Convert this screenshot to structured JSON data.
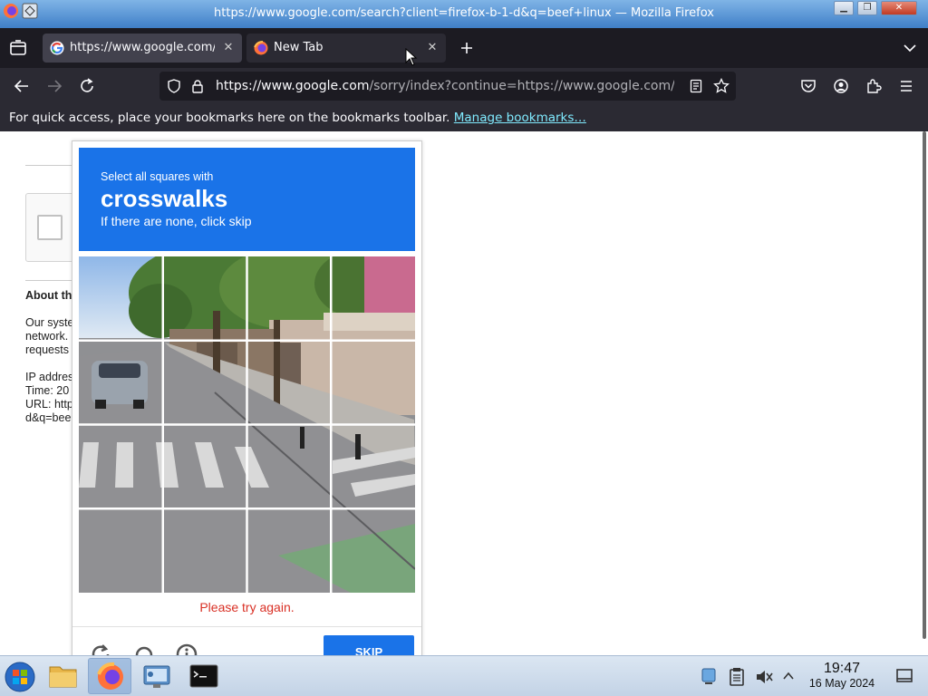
{
  "window": {
    "title": "https://www.google.com/search?client=firefox-b-1-d&q=beef+linux — Mozilla Firefox"
  },
  "tabs": [
    {
      "label": "https://www.google.com/",
      "favicon": "google-icon",
      "active": true
    },
    {
      "label": "New Tab",
      "favicon": "firefox-icon",
      "active": false
    }
  ],
  "navbar": {
    "url_domain": "https://www.google.com",
    "url_rest": "/sorry/index?continue=https://www.google.com/s"
  },
  "bookmarks_bar": {
    "message": "For quick access, place your bookmarks here on the bookmarks toolbar.",
    "link": "Manage bookmarks…"
  },
  "background_page": {
    "about_heading": "About th",
    "lines": [
      "Our syste",
      "network.",
      "requests"
    ],
    "ip": "IP addres",
    "time": "Time: 20",
    "url": "URL: http",
    "url2": "d&q=bee"
  },
  "captcha": {
    "instruction_small": "Select all squares with",
    "target": "crosswalks",
    "instruction_hint": "If there are none, click skip",
    "error": "Please try again.",
    "skip_label": "SKIP",
    "grid_size": 4
  },
  "taskbar": {
    "time": "19:47",
    "date": "16 May 2024"
  },
  "colors": {
    "captcha_blue": "#1a73e8",
    "error_red": "#d93025",
    "firefox_dark": "#1c1b22",
    "toolbar": "#2b2a33"
  }
}
